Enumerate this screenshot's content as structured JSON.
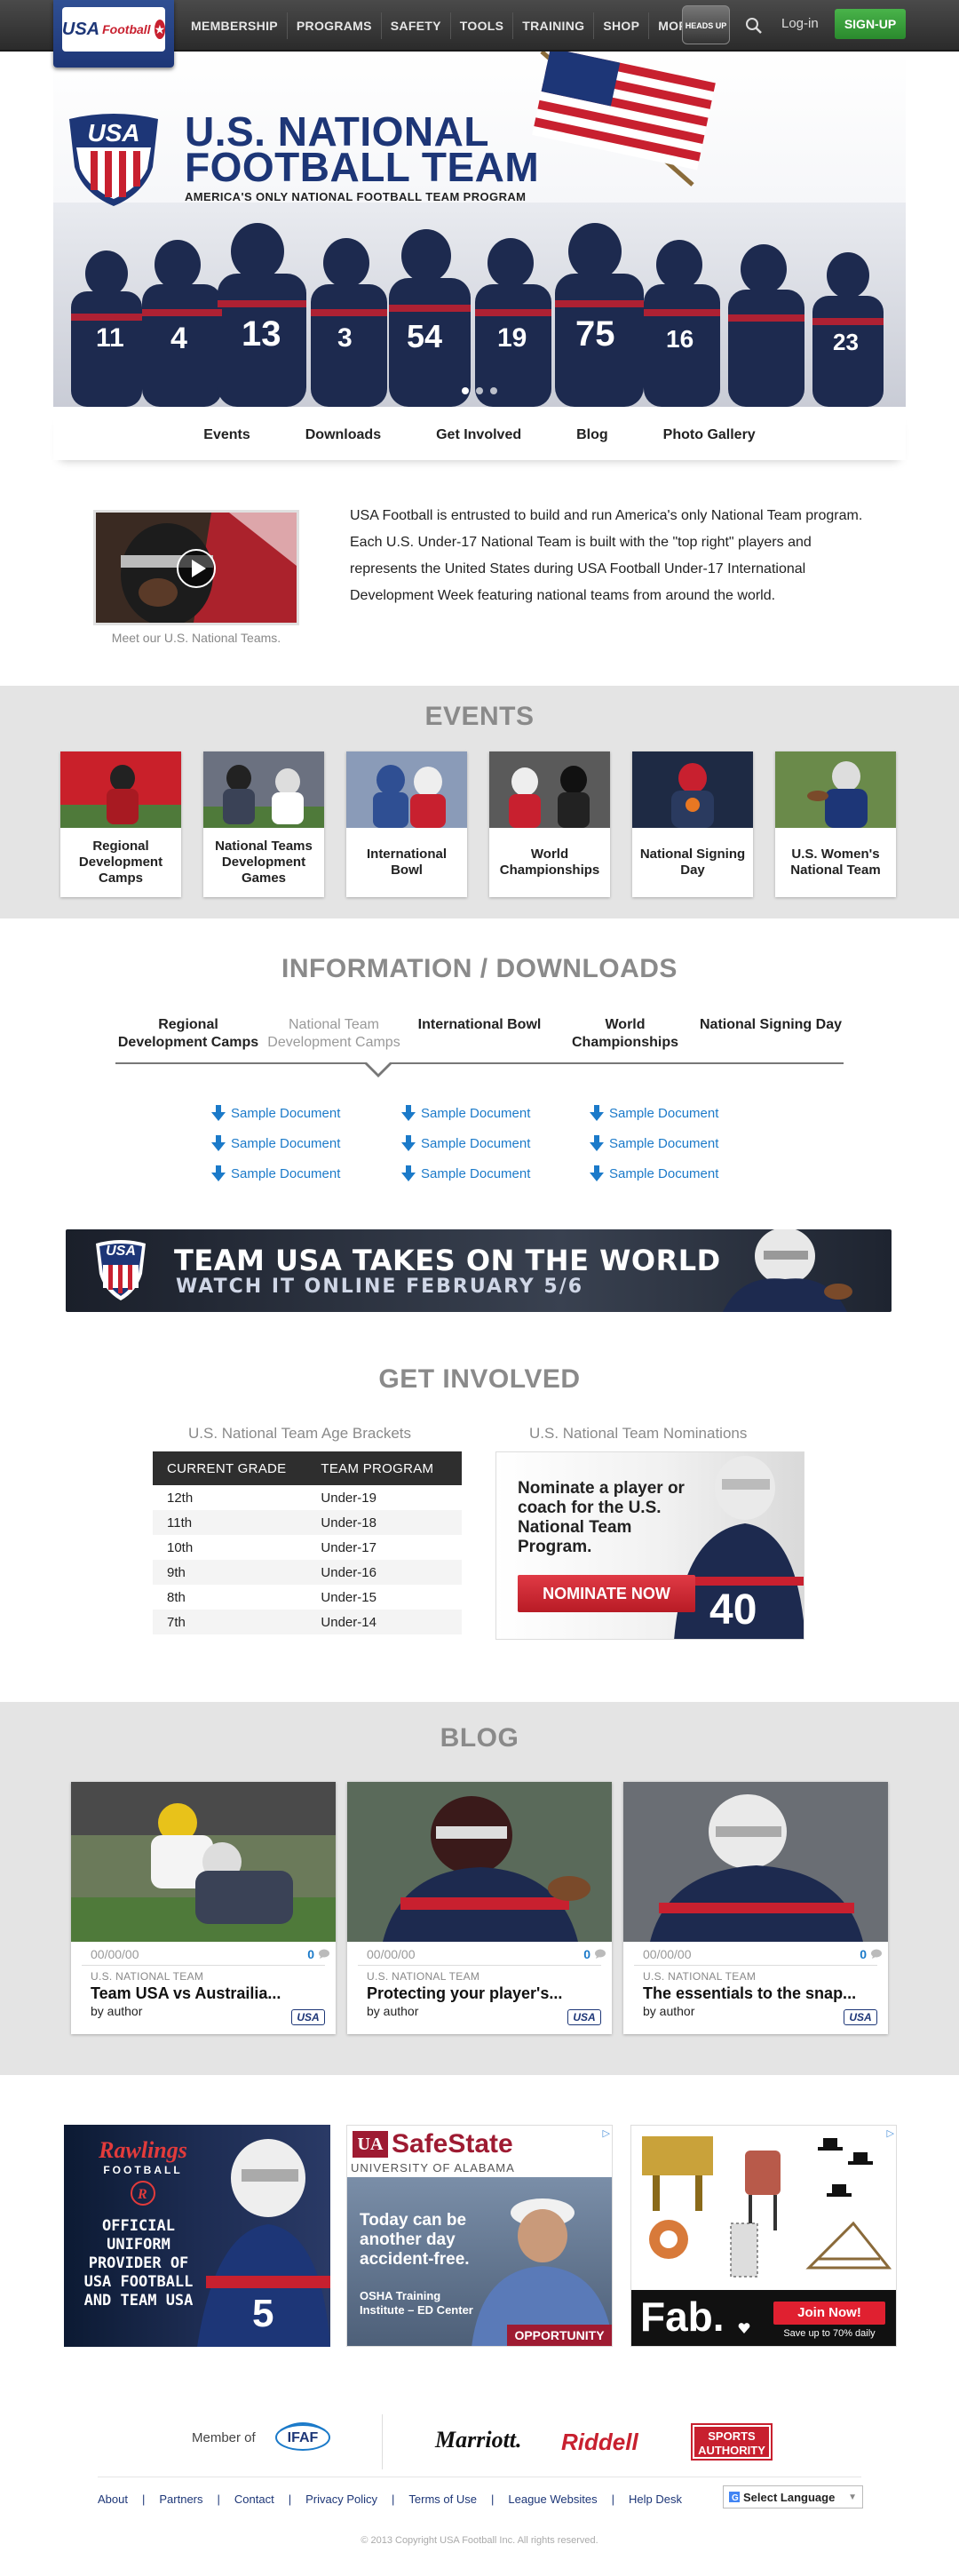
{
  "nav": {
    "logo_usa": "USA",
    "logo_football": "Football",
    "items": [
      "MEMBERSHIP",
      "PROGRAMS",
      "SAFETY",
      "TOOLS",
      "TRAINING",
      "SHOP",
      "MORE"
    ],
    "headsup_label": "HEADS UP",
    "login": "Log-in",
    "signup": "SIGN-UP"
  },
  "hero": {
    "badge_text": "USA",
    "title_line1": "U.S. NATIONAL",
    "title_line2": "FOOTBALL TEAM",
    "subtitle": "AMERICA'S ONLY NATIONAL FOOTBALL TEAM PROGRAM",
    "jersey_numbers": [
      "11",
      "4",
      "13",
      "3",
      "54",
      "19",
      "75",
      "16",
      "23"
    ]
  },
  "subnav": [
    "Events",
    "Downloads",
    "Get Involved",
    "Blog",
    "Photo Gallery"
  ],
  "intro": {
    "video_caption": "Meet our U.S. National Teams.",
    "paragraph": "USA Football is entrusted to build and run America's only National Team program. Each U.S. Under-17 National Team is built with the \"top right\" players and represents the United States during USA Football Under-17 International Development Week featuring national teams from around the world."
  },
  "events": {
    "title": "EVENTS",
    "cards": [
      {
        "label": "Regional Development Camps",
        "color": "#c9202a"
      },
      {
        "label": "National Teams Development Games",
        "color": "#3a4256"
      },
      {
        "label": "International Bowl",
        "color": "#2f4f93"
      },
      {
        "label": "World Championships",
        "color": "#3b3b3b"
      },
      {
        "label": "National Signing Day",
        "color": "#1e2a44"
      },
      {
        "label": "U.S. Women's National Team",
        "color": "#5a7a3a"
      }
    ]
  },
  "downloads": {
    "title": "INFORMATION / DOWNLOADS",
    "tabs": [
      {
        "label": "Regional Development Camps",
        "active": false
      },
      {
        "label": "National Team Development Camps",
        "active": true
      },
      {
        "label": "International Bowl",
        "active": false
      },
      {
        "label": "World Championships",
        "active": false
      },
      {
        "label": "National Signing Day",
        "active": false
      }
    ],
    "columns": [
      [
        "Sample Document",
        "Sample Document",
        "Sample Document"
      ],
      [
        "Sample Document",
        "Sample Document",
        "Sample Document"
      ],
      [
        "Sample Document",
        "Sample Document",
        "Sample Document"
      ]
    ]
  },
  "promo": {
    "badge": "USA",
    "line1": "TEAM USA TAKES ON THE WORLD",
    "line2": "WATCH IT ONLINE FEBRUARY 5/6"
  },
  "involved": {
    "title": "GET INVOLVED",
    "brackets_title": "U.S. National Team Age Brackets",
    "nominations_title": "U.S. National Team Nominations",
    "table_headers": [
      "CURRENT GRADE",
      "TEAM PROGRAM"
    ],
    "rows": [
      [
        "12th",
        "Under-19"
      ],
      [
        "11th",
        "Under-18"
      ],
      [
        "10th",
        "Under-17"
      ],
      [
        "9th",
        "Under-16"
      ],
      [
        "8th",
        "Under-15"
      ],
      [
        "7th",
        "Under-14"
      ]
    ],
    "nominate_text": "Nominate a player or coach for the U.S. National Team Program.",
    "nominate_button": "NOMINATE NOW",
    "nominate_jersey": "40"
  },
  "blog": {
    "title": "BLOG",
    "posts": [
      {
        "date": "00/00/00",
        "count": "0",
        "category": "U.S. NATIONAL TEAM",
        "title": "Team USA vs Austrailia...",
        "author": "by author",
        "badge": "USA"
      },
      {
        "date": "00/00/00",
        "count": "0",
        "category": "U.S. NATIONAL TEAM",
        "title": "Protecting your player's...",
        "author": "by author",
        "badge": "USA"
      },
      {
        "date": "00/00/00",
        "count": "0",
        "category": "U.S. NATIONAL TEAM",
        "title": "The essentials to the snap...",
        "author": "by author",
        "badge": "USA"
      }
    ]
  },
  "ads": {
    "rawlings_logo": "Rawlings",
    "rawlings_sub": "FOOTBALL",
    "rawlings_text": "OFFICIAL UNIFORM PROVIDER OF USA FOOTBALL AND TEAM USA",
    "rawlings_jersey": "5",
    "safe_ua": "UA",
    "safe_brand": "SafeState",
    "safe_univ": "UNIVERSITY OF ALABAMA",
    "safe_tag": "Today can be another day accident-free.",
    "safe_osha": "OSHA Training Institute – ED Center",
    "safe_opp": "OPPORTUNITY",
    "fab_logo": "Fab.",
    "fab_button": "Join Now!",
    "fab_sub": "Save up to 70% daily"
  },
  "footer": {
    "member_of": "Member of",
    "ifaf": "IFAF",
    "sponsors": [
      "Marriott.",
      "Riddell",
      "SPORTS AUTHORITY"
    ],
    "links": [
      "About",
      "Partners",
      "Contact",
      "Privacy Policy",
      "Terms of Use",
      "League Websites",
      "Help Desk"
    ],
    "language": "Select Language",
    "copyright": "© 2013 Copyright USA Football Inc. All rights reserved."
  },
  "colors": {
    "navy": "#1d3677",
    "red": "#c8202f",
    "link": "#1b7ac9",
    "green": "#2a8a2d"
  }
}
